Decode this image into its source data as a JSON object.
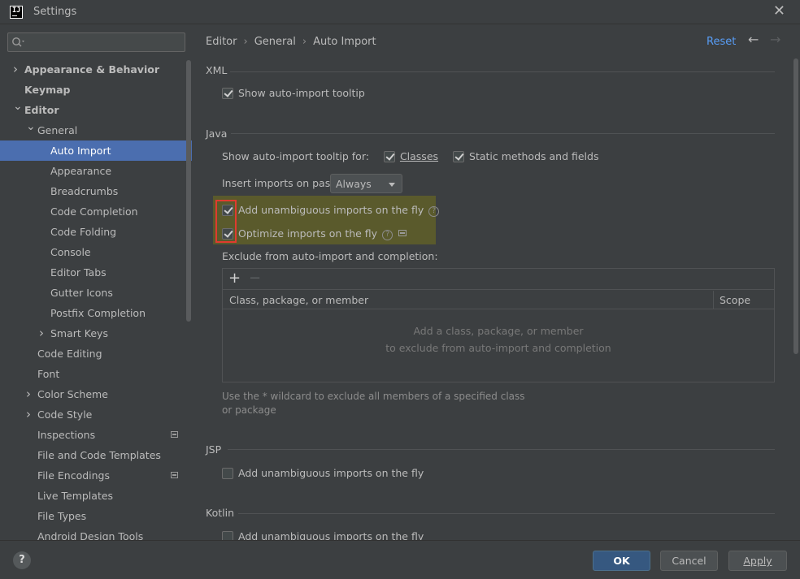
{
  "window": {
    "title": "Settings",
    "logo_text": "IJ"
  },
  "search": {
    "placeholder": ""
  },
  "sidebar": {
    "items": [
      {
        "label": "Appearance & Behavior",
        "level": 0,
        "chevron": "right",
        "bold": true
      },
      {
        "label": "Keymap",
        "level": 0,
        "chevron": "",
        "bold": true
      },
      {
        "label": "Editor",
        "level": 0,
        "chevron": "down",
        "bold": true
      },
      {
        "label": "General",
        "level": 1,
        "chevron": "down"
      },
      {
        "label": "Auto Import",
        "level": 2,
        "chevron": "",
        "selected": true
      },
      {
        "label": "Appearance",
        "level": 2,
        "chevron": ""
      },
      {
        "label": "Breadcrumbs",
        "level": 2,
        "chevron": ""
      },
      {
        "label": "Code Completion",
        "level": 2,
        "chevron": ""
      },
      {
        "label": "Code Folding",
        "level": 2,
        "chevron": ""
      },
      {
        "label": "Console",
        "level": 2,
        "chevron": ""
      },
      {
        "label": "Editor Tabs",
        "level": 2,
        "chevron": ""
      },
      {
        "label": "Gutter Icons",
        "level": 2,
        "chevron": ""
      },
      {
        "label": "Postfix Completion",
        "level": 2,
        "chevron": ""
      },
      {
        "label": "Smart Keys",
        "level": 2,
        "chevron": "right"
      },
      {
        "label": "Code Editing",
        "level": 1,
        "chevron": ""
      },
      {
        "label": "Font",
        "level": 1,
        "chevron": ""
      },
      {
        "label": "Color Scheme",
        "level": 1,
        "chevron": "right"
      },
      {
        "label": "Code Style",
        "level": 1,
        "chevron": "right"
      },
      {
        "label": "Inspections",
        "level": 1,
        "chevron": "",
        "badge": true
      },
      {
        "label": "File and Code Templates",
        "level": 1,
        "chevron": ""
      },
      {
        "label": "File Encodings",
        "level": 1,
        "chevron": "",
        "badge": true
      },
      {
        "label": "Live Templates",
        "level": 1,
        "chevron": ""
      },
      {
        "label": "File Types",
        "level": 1,
        "chevron": ""
      },
      {
        "label": "Android Design Tools",
        "level": 1,
        "chevron": ""
      }
    ]
  },
  "header": {
    "breadcrumb": [
      "Editor",
      "General",
      "Auto Import"
    ],
    "reset_label": "Reset"
  },
  "xml": {
    "title": "XML",
    "show_tooltip": {
      "label": "Show auto-import tooltip",
      "checked": true
    }
  },
  "java": {
    "title": "Java",
    "tooltip_for_label": "Show auto-import tooltip for:",
    "classes": {
      "label": "Classes",
      "checked": true
    },
    "static_methods": {
      "label": "Static methods and fields",
      "checked": true
    },
    "insert_on_paste_label": "Insert imports on paste:",
    "insert_on_paste_value": "Always",
    "add_unambiguous": {
      "label": "Add unambiguous imports on the fly",
      "checked": true
    },
    "optimize_imports": {
      "label": "Optimize imports on the fly",
      "checked": true
    },
    "exclude_label": "Exclude from auto-import and completion:",
    "table_columns": [
      "Class, package, or member",
      "Scope"
    ],
    "empty_line1": "Add a class, package, or member",
    "empty_line2": "to exclude from auto-import and completion",
    "hint": "Use the * wildcard to exclude all members of a specified class or package"
  },
  "jsp": {
    "title": "JSP",
    "add_unambiguous": {
      "label": "Add unambiguous imports on the fly",
      "checked": false
    }
  },
  "kotlin": {
    "title": "Kotlin",
    "add_unambiguous": {
      "label": "Add unambiguous imports on the fly",
      "checked": false
    }
  },
  "footer": {
    "help_label": "?",
    "ok_label": "OK",
    "cancel_label": "Cancel",
    "apply_label": "Apply"
  },
  "colors": {
    "accent": "#4b6eaf",
    "link": "#589df6",
    "highlight": "#5a5a2c",
    "marker": "#e03b2f"
  }
}
